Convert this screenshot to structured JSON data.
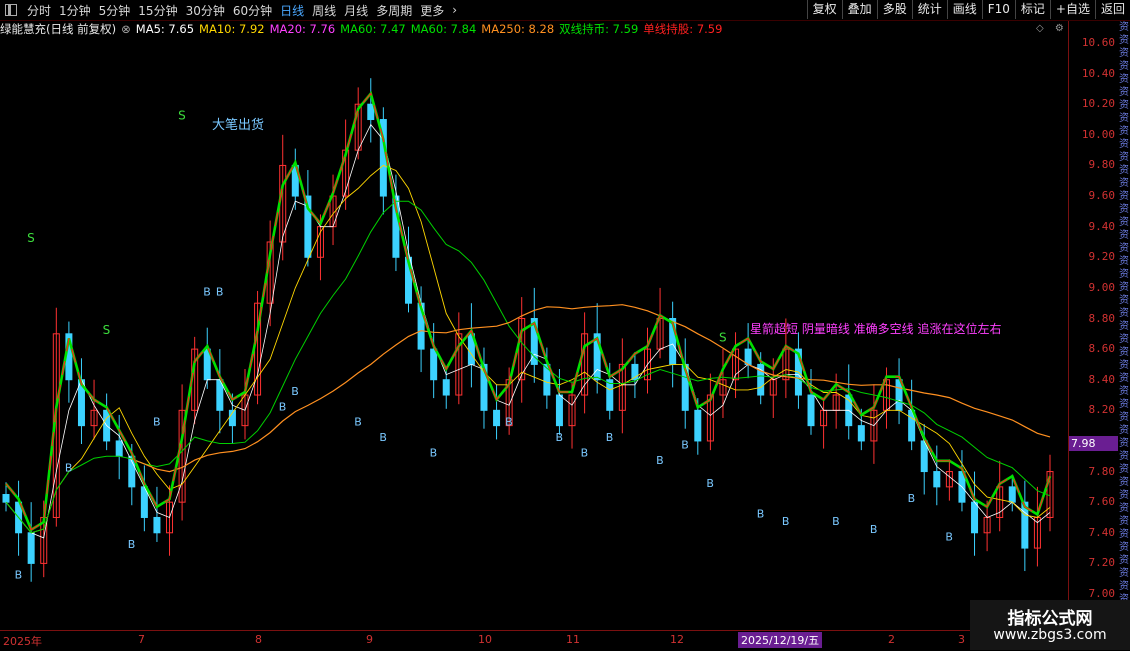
{
  "toolbar": {
    "periods": [
      "分时",
      "1分钟",
      "5分钟",
      "15分钟",
      "30分钟",
      "60分钟",
      "日线",
      "周线",
      "月线",
      "多周期",
      "更多"
    ],
    "more_arrow": "›",
    "active_index": 6,
    "right_buttons": [
      "复权",
      "叠加",
      "多股",
      "统计",
      "画线",
      "F10",
      "标记",
      "+自选",
      "返回"
    ]
  },
  "legend": {
    "title": "绿能慧充(日线 前复权)",
    "items": [
      {
        "label": "MA5: 7.65",
        "color": "#ffffff"
      },
      {
        "label": "MA10: 7.92",
        "color": "#ffd700"
      },
      {
        "label": "MA20: 7.76",
        "color": "#ff40ff"
      },
      {
        "label": "MA60: 7.47",
        "color": "#00e000"
      },
      {
        "label": "MA60: 7.84",
        "color": "#00e000"
      },
      {
        "label": "MA250: 8.28",
        "color": "#ff9020"
      },
      {
        "label": "双线持币: 7.59",
        "color": "#00e000"
      },
      {
        "label": "单线持股: 7.59",
        "color": "#ff2020"
      }
    ]
  },
  "yaxis": {
    "min": 7.0,
    "max": 10.6,
    "ticks": [
      "10.60",
      "10.40",
      "10.20",
      "10.00",
      "9.80",
      "9.60",
      "9.40",
      "9.20",
      "9.00",
      "8.80",
      "8.60",
      "8.40",
      "8.20",
      "7.80",
      "7.60",
      "7.40",
      "7.20",
      "7.00"
    ],
    "current": "7.98"
  },
  "xaxis": {
    "labels": [
      "2025年",
      "7",
      "8",
      "9",
      "10",
      "11",
      "12",
      "2",
      "3"
    ],
    "selected": "2025/12/19/五"
  },
  "annotations": {
    "signal_text": "大笔出货",
    "overlap_text": "星箭超短 阴量暗线 准确多空线 追涨在这位左右",
    "sell": "S",
    "buy": "B"
  },
  "side_text": [
    "资",
    "资",
    "资",
    "资",
    "资",
    "资",
    "资",
    "资",
    "资",
    "资",
    "资",
    "资",
    "资",
    "资",
    "资",
    "资",
    "资",
    "资",
    "资",
    "资",
    "资",
    "资",
    "资",
    "资",
    "资",
    "资",
    "资",
    "资",
    "资",
    "资",
    "资",
    "资",
    "资",
    "资",
    "资",
    "资",
    "资",
    "资",
    "资",
    "资",
    "资",
    "资",
    "资",
    "资",
    "资",
    "资",
    "资"
  ],
  "watermark": {
    "line1": "指标公式网",
    "line2": "www.zbgs3.com"
  },
  "chart_data": {
    "type": "line",
    "title": "绿能慧充(日线 前复权)",
    "ylim": [
      7.0,
      10.6
    ],
    "x_months": [
      "2025年",
      "7",
      "8",
      "9",
      "10",
      "11",
      "12",
      "2",
      "3"
    ],
    "close_series": [
      7.6,
      7.4,
      7.2,
      7.5,
      8.7,
      8.4,
      8.1,
      8.2,
      8.0,
      7.9,
      7.7,
      7.5,
      7.4,
      7.6,
      8.2,
      8.6,
      8.4,
      8.2,
      8.1,
      8.3,
      8.9,
      9.3,
      9.8,
      9.6,
      9.2,
      9.4,
      9.6,
      9.9,
      10.2,
      10.1,
      9.6,
      9.2,
      8.9,
      8.6,
      8.4,
      8.3,
      8.7,
      8.5,
      8.2,
      8.1,
      8.4,
      8.8,
      8.5,
      8.3,
      8.1,
      8.3,
      8.7,
      8.4,
      8.2,
      8.5,
      8.4,
      8.6,
      8.8,
      8.5,
      8.2,
      8.0,
      8.3,
      8.4,
      8.6,
      8.5,
      8.3,
      8.4,
      8.6,
      8.3,
      8.1,
      8.2,
      8.3,
      8.1,
      8.0,
      8.2,
      8.4,
      8.2,
      8.0,
      7.8,
      7.7,
      7.8,
      7.6,
      7.4,
      7.5,
      7.7,
      7.6,
      7.3,
      7.5,
      7.8
    ],
    "series": [
      {
        "name": "MA5",
        "value": 7.65
      },
      {
        "name": "MA10",
        "value": 7.92
      },
      {
        "name": "MA20",
        "value": 7.76
      },
      {
        "name": "MA60",
        "value": 7.47
      },
      {
        "name": "MA60",
        "value": 7.84
      },
      {
        "name": "MA250",
        "value": 8.28
      },
      {
        "name": "双线持币",
        "value": 7.59
      },
      {
        "name": "单线持股",
        "value": 7.59
      }
    ],
    "sell_signals": [
      [
        2,
        9.3
      ],
      [
        8,
        8.7
      ],
      [
        14,
        10.1
      ],
      [
        57,
        8.65
      ]
    ],
    "buy_signals": [
      [
        1,
        7.1
      ],
      [
        5,
        7.8
      ],
      [
        10,
        7.3
      ],
      [
        12,
        8.1
      ],
      [
        16,
        8.95
      ],
      [
        17,
        8.95
      ],
      [
        22,
        8.2
      ],
      [
        23,
        8.3
      ],
      [
        28,
        8.1
      ],
      [
        30,
        8.0
      ],
      [
        34,
        7.9
      ],
      [
        40,
        8.1
      ],
      [
        44,
        8.0
      ],
      [
        46,
        7.9
      ],
      [
        48,
        8.0
      ],
      [
        52,
        7.85
      ],
      [
        54,
        7.95
      ],
      [
        56,
        7.7
      ],
      [
        60,
        7.5
      ],
      [
        62,
        7.45
      ],
      [
        66,
        7.45
      ],
      [
        69,
        7.4
      ],
      [
        72,
        7.6
      ],
      [
        75,
        7.35
      ]
    ]
  }
}
